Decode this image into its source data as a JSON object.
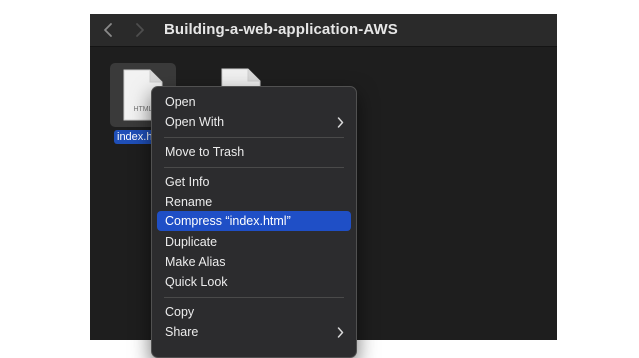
{
  "window": {
    "title": "Building-a-web-application-AWS"
  },
  "files": [
    {
      "label": "index.h",
      "icon": "html-file-icon",
      "type_tag": "HTML",
      "selected": true
    },
    {
      "label": "",
      "icon": "file-icon",
      "selected": false
    }
  ],
  "context_menu": {
    "items": [
      {
        "label": "Open",
        "submenu": false
      },
      {
        "label": "Open With",
        "submenu": true
      },
      {
        "label": "Move to Trash",
        "submenu": false
      },
      {
        "label": "Get Info",
        "submenu": false
      },
      {
        "label": "Rename",
        "submenu": false
      },
      {
        "label": "Compress “index.html”",
        "submenu": false,
        "highlighted": true
      },
      {
        "label": "Duplicate",
        "submenu": false
      },
      {
        "label": "Make Alias",
        "submenu": false
      },
      {
        "label": "Quick Look",
        "submenu": false
      },
      {
        "label": "Copy",
        "submenu": false
      },
      {
        "label": "Share",
        "submenu": true
      }
    ]
  },
  "colors": {
    "window_bg": "#1e1e1e",
    "titlebar_bg": "#2a2a2a",
    "menu_bg": "#2c2c2e",
    "highlight": "#1f4fc6",
    "selection_label": "#1f4fb8"
  }
}
